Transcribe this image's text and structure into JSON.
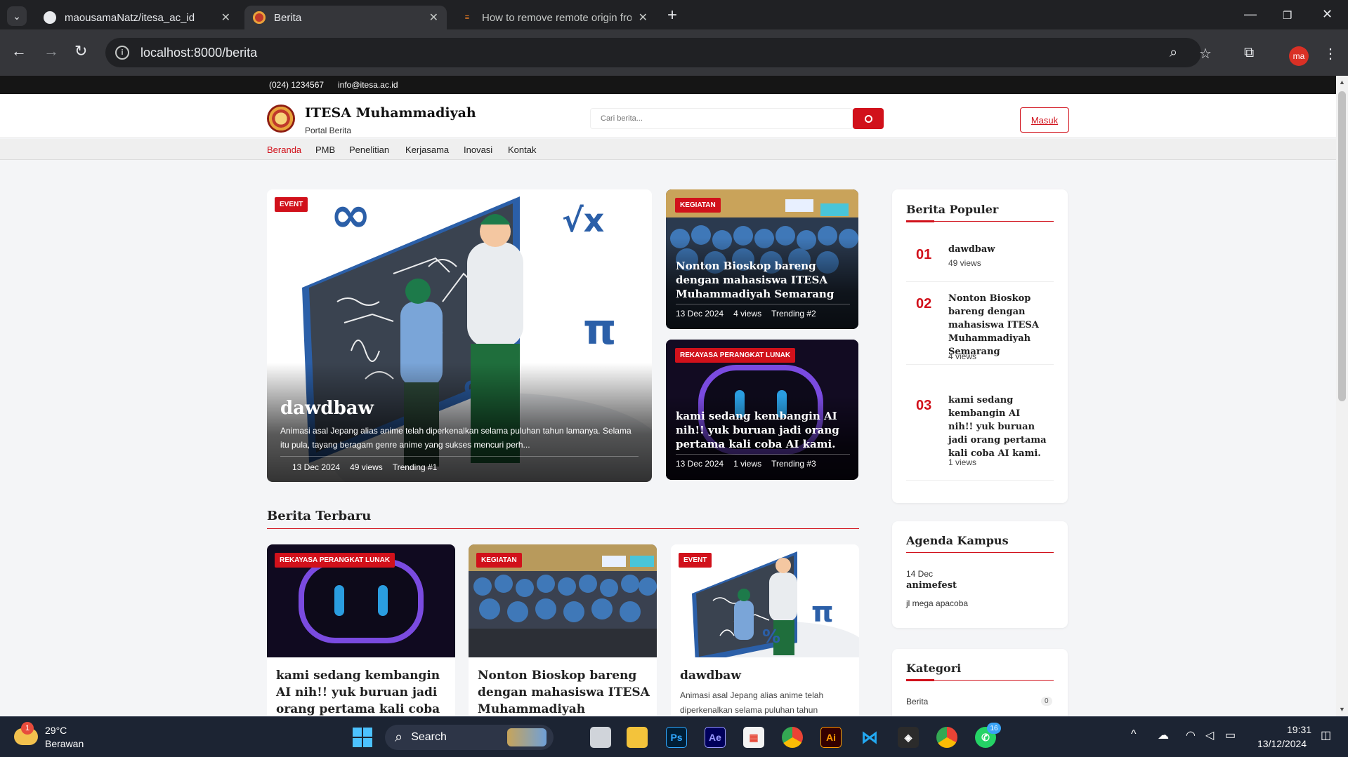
{
  "browser": {
    "tabs": [
      {
        "title": "maousamaNatz/itesa_ac_id",
        "icon": "github-icon"
      },
      {
        "title": "Berita",
        "icon": "itesa-favicon"
      },
      {
        "title": "How to remove remote origin from",
        "icon": "stackoverflow-icon"
      }
    ],
    "active_tab": 1,
    "url": "localhost:8000/berita",
    "profile_initials": "ma"
  },
  "site": {
    "topbar": {
      "phone": "(024) 1234567",
      "email": "info@itesa.ac.id"
    },
    "brand": {
      "title": "ITESA Muhammadiyah",
      "subtitle": "Portal Berita"
    },
    "search": {
      "placeholder": "Cari berita..."
    },
    "login_label": "Masuk",
    "nav": [
      "Beranda",
      "PMB",
      "Penelitian",
      "Kerjasama",
      "Inovasi",
      "Kontak"
    ],
    "active_nav": "Beranda",
    "accent_color": "#d1111b"
  },
  "featured": {
    "main": {
      "badge": "EVENT",
      "title": "dawdbaw",
      "excerpt": "Animasi asal Jepang alias anime telah diperkenalkan selama puluhan tahun lamanya. Selama itu pula, tayang beragam genre anime yang sukses mencuri perh...",
      "date": "13 Dec 2024",
      "views": "49 views",
      "trending": "Trending #1"
    },
    "side": [
      {
        "badge": "KEGIATAN",
        "title": "Nonton Bioskop bareng dengan mahasiswa ITESA Muhammadiyah Semarang",
        "date": "13 Dec 2024",
        "views": "4 views",
        "trending": "Trending #2"
      },
      {
        "badge": "REKAYASA PERANGKAT LUNAK",
        "title": "kami sedang kembangin AI nih!! yuk buruan jadi orang pertama kali coba AI kami.",
        "date": "13 Dec 2024",
        "views": "1 views",
        "trending": "Trending #3"
      }
    ]
  },
  "latest": {
    "heading": "Berita Terbaru",
    "items": [
      {
        "badge": "REKAYASA PERANGKAT LUNAK",
        "title": "kami sedang kembangin AI nih!! yuk buruan jadi orang pertama kali coba AI kami."
      },
      {
        "badge": "KEGIATAN",
        "title": "Nonton Bioskop bareng dengan mahasiswa ITESA Muhammadiyah Semarang"
      },
      {
        "badge": "EVENT",
        "title": "dawdbaw",
        "excerpt": "Animasi asal Jepang alias anime telah diperkenalkan selama puluhan tahun"
      }
    ]
  },
  "sidebar": {
    "popular": {
      "heading": "Berita Populer",
      "items": [
        {
          "rank": "01",
          "title": "dawdbaw",
          "views": "49 views"
        },
        {
          "rank": "02",
          "title": "Nonton Bioskop bareng dengan mahasiswa ITESA Muhammadiyah Semarang",
          "views": "4 views"
        },
        {
          "rank": "03",
          "title": "kami sedang kembangin AI nih!! yuk buruan jadi orang pertama kali coba AI kami.",
          "views": "1 views"
        }
      ]
    },
    "agenda": {
      "heading": "Agenda Kampus",
      "items": [
        {
          "date": "14 Dec",
          "title": "animefest",
          "location": "jl mega apacoba"
        }
      ]
    },
    "categories": {
      "heading": "Kategori",
      "items": [
        {
          "name": "Berita",
          "count": "0"
        }
      ]
    }
  },
  "taskbar": {
    "weather": {
      "temp": "29°C",
      "condition": "Berawan",
      "badge": "1"
    },
    "search_label": "Search",
    "clock": {
      "time": "19:31",
      "date": "13/12/2024"
    },
    "whatsapp_badge": "16"
  }
}
